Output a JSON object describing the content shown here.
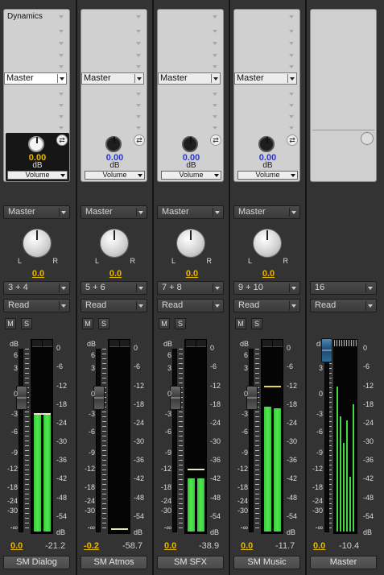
{
  "colors": {
    "meter_green": "#51e64f",
    "value_yellow": "#e8b800",
    "send_blue": "#2a38c9",
    "background": "#2e2e2e"
  },
  "insert_label": "Dynamics",
  "master_channel": {
    "output": "16",
    "automation": "Read",
    "volume": "0.0",
    "peak": "-10.4",
    "name": "Master",
    "meter_level_fraction": 0.62
  },
  "db_label": "dB",
  "scale_left": [
    "6",
    "3",
    "0",
    "-3",
    "-6",
    "-9",
    "-12",
    "-18",
    "-24",
    "-30",
    "-∞"
  ],
  "scale_right": [
    "0",
    "-6",
    "-12",
    "-18",
    "-24",
    "-30",
    "-36",
    "-42",
    "-48",
    "-54",
    "dB"
  ],
  "pan_left": "L",
  "pan_right": "R",
  "mute_label": "M",
  "solo_label": "S",
  "channels": [
    {
      "name": "SM Dialog",
      "send_name": "Master",
      "send_value": "0.00",
      "send_unit": "dB",
      "send_mode": "Volume",
      "pan_send": "Master",
      "pan_value": "0.0",
      "output": "3 + 4",
      "automation": "Read",
      "volume": "0.0",
      "peak": "-21.2",
      "meter_level_fraction": 0.62
    },
    {
      "name": "SM Atmos",
      "send_name": "Master",
      "send_value": "0.00",
      "send_unit": "dB",
      "send_mode": "Volume",
      "pan_send": "Master",
      "pan_value": "0.0",
      "output": "5 + 6",
      "automation": "Read",
      "volume": "-0.2",
      "peak": "-58.7",
      "meter_level_fraction": 0.0
    },
    {
      "name": "SM SFX",
      "send_name": "Master",
      "send_value": "0.00",
      "send_unit": "dB",
      "send_mode": "Volume",
      "pan_send": "Master",
      "pan_value": "0.0",
      "output": "7 + 8",
      "automation": "Read",
      "volume": "0.0",
      "peak": "-38.9",
      "meter_level_fraction": 0.3
    },
    {
      "name": "SM Music",
      "send_name": "Master",
      "send_value": "0.00",
      "send_unit": "dB",
      "send_mode": "Volume",
      "pan_send": "Master",
      "pan_value": "0.0",
      "output": "9 + 10",
      "automation": "Read",
      "volume": "0.0",
      "peak": "-11.7",
      "meter_level_fraction": 0.68
    }
  ]
}
